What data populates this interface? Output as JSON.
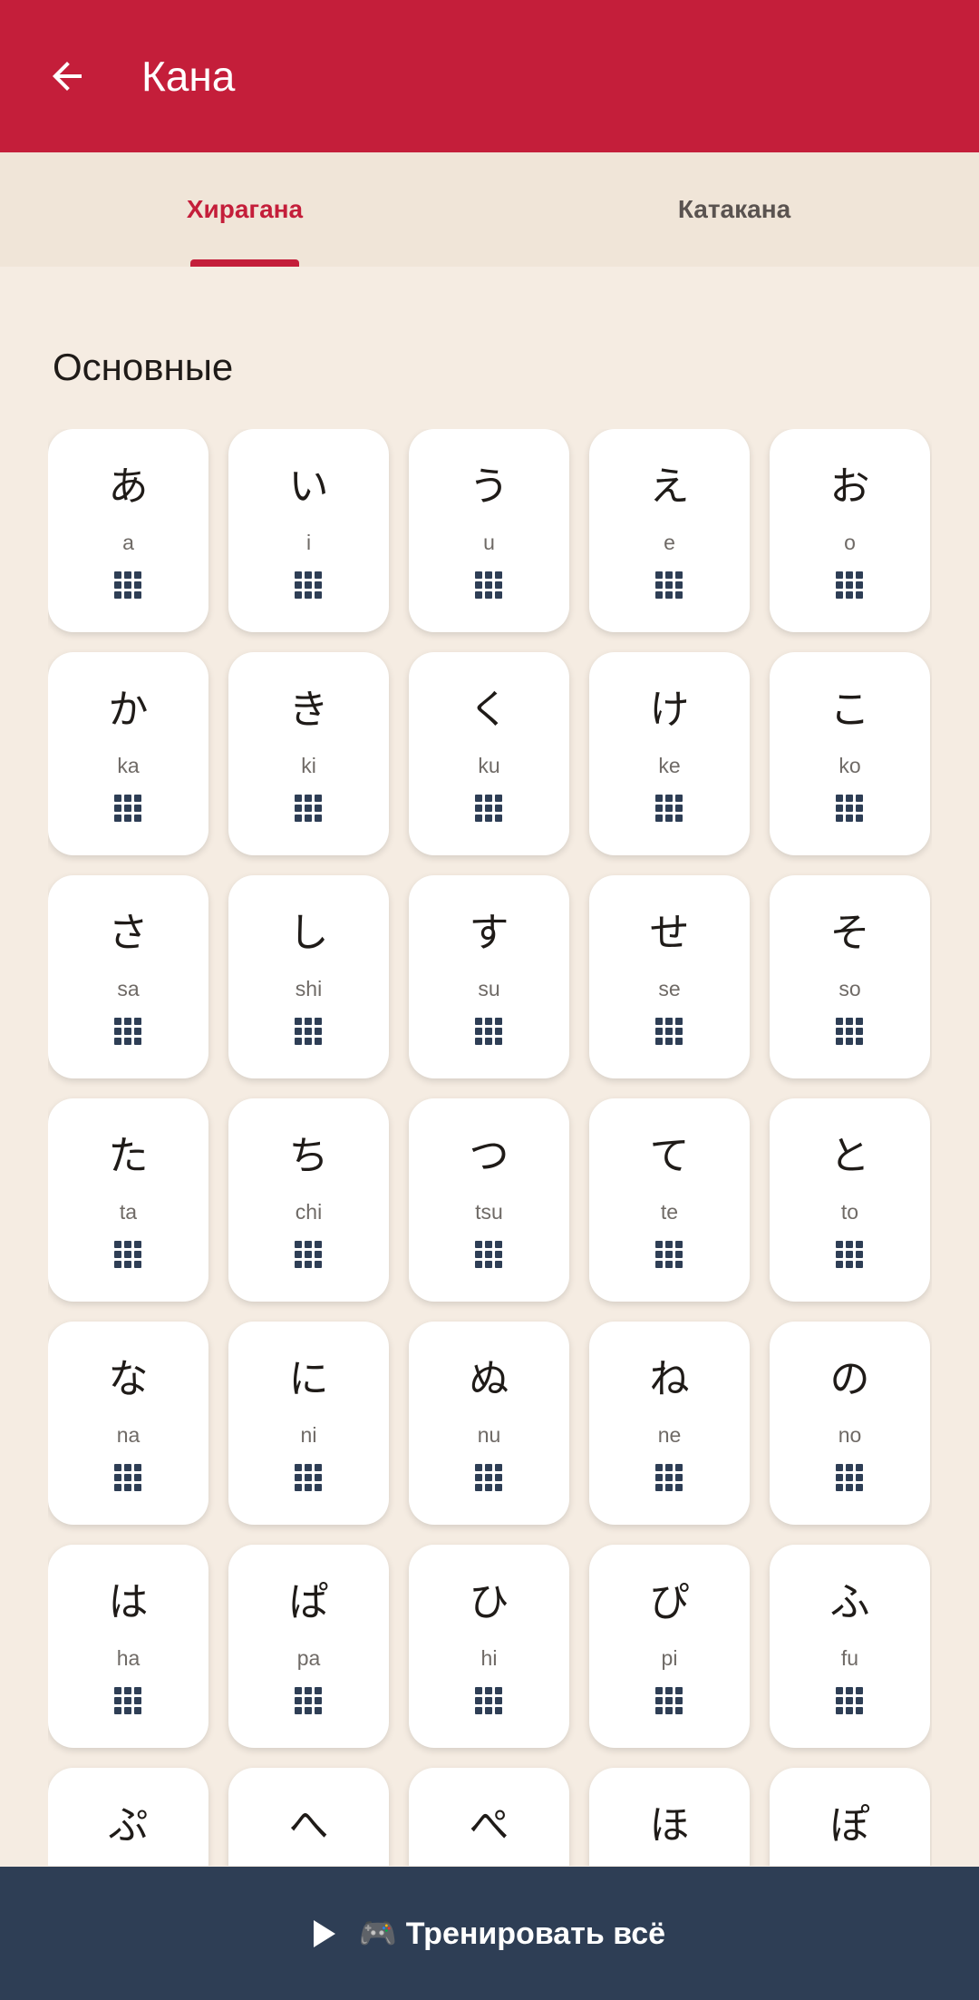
{
  "appbar": {
    "title": "Кана",
    "accent": "#C41E3A"
  },
  "tabs": [
    {
      "label": "Хирагана",
      "active": true
    },
    {
      "label": "Катакана",
      "active": false
    }
  ],
  "section": {
    "title": "Основные"
  },
  "cards": [
    {
      "kana": "あ",
      "romaji": "a"
    },
    {
      "kana": "い",
      "romaji": "i"
    },
    {
      "kana": "う",
      "romaji": "u"
    },
    {
      "kana": "え",
      "romaji": "e"
    },
    {
      "kana": "お",
      "romaji": "o"
    },
    {
      "kana": "か",
      "romaji": "ka"
    },
    {
      "kana": "き",
      "romaji": "ki"
    },
    {
      "kana": "く",
      "romaji": "ku"
    },
    {
      "kana": "け",
      "romaji": "ke"
    },
    {
      "kana": "こ",
      "romaji": "ko"
    },
    {
      "kana": "さ",
      "romaji": "sa"
    },
    {
      "kana": "し",
      "romaji": "shi"
    },
    {
      "kana": "す",
      "romaji": "su"
    },
    {
      "kana": "せ",
      "romaji": "se"
    },
    {
      "kana": "そ",
      "romaji": "so"
    },
    {
      "kana": "た",
      "romaji": "ta"
    },
    {
      "kana": "ち",
      "romaji": "chi"
    },
    {
      "kana": "つ",
      "romaji": "tsu"
    },
    {
      "kana": "て",
      "romaji": "te"
    },
    {
      "kana": "と",
      "romaji": "to"
    },
    {
      "kana": "な",
      "romaji": "na"
    },
    {
      "kana": "に",
      "romaji": "ni"
    },
    {
      "kana": "ぬ",
      "romaji": "nu"
    },
    {
      "kana": "ね",
      "romaji": "ne"
    },
    {
      "kana": "の",
      "romaji": "no"
    },
    {
      "kana": "は",
      "romaji": "ha"
    },
    {
      "kana": "ぱ",
      "romaji": "pa"
    },
    {
      "kana": "ひ",
      "romaji": "hi"
    },
    {
      "kana": "ぴ",
      "romaji": "pi"
    },
    {
      "kana": "ふ",
      "romaji": "fu"
    },
    {
      "kana": "ぷ",
      "romaji": ""
    },
    {
      "kana": "へ",
      "romaji": ""
    },
    {
      "kana": "ぺ",
      "romaji": ""
    },
    {
      "kana": "ほ",
      "romaji": ""
    },
    {
      "kana": "ぽ",
      "romaji": ""
    }
  ],
  "bottom_button": {
    "label": "🎮 Тренировать всё"
  },
  "icons": {
    "back": "arrow-left-icon",
    "card": "grid-icon",
    "train": "play-icon"
  }
}
